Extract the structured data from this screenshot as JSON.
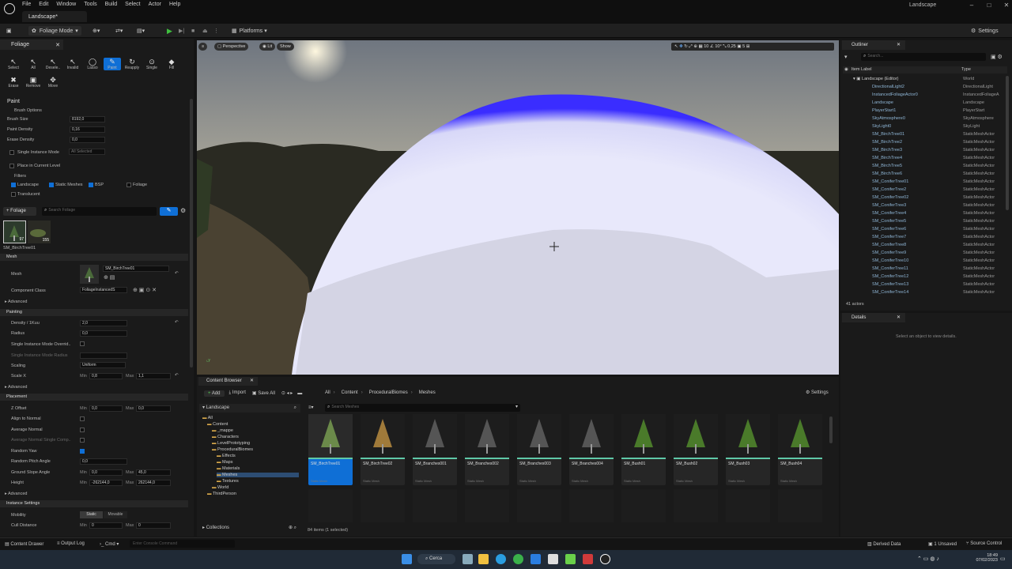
{
  "window": {
    "doc_tab": "Landscape*",
    "project": "Landscape"
  },
  "menu": [
    "File",
    "Edit",
    "Window",
    "Tools",
    "Build",
    "Select",
    "Actor",
    "Help"
  ],
  "toolbar": {
    "mode": "Foliage Mode",
    "platforms": "Platforms",
    "settings": "Settings"
  },
  "foliage_panel": {
    "tab": "Foliage",
    "tools": [
      {
        "label": "Select",
        "g": "↖"
      },
      {
        "label": "All",
        "g": "↖"
      },
      {
        "label": "Desele..",
        "g": "↖"
      },
      {
        "label": "Invalid",
        "g": "↖"
      },
      {
        "label": "Lasso",
        "g": "◯"
      },
      {
        "label": "Paint",
        "g": "✎"
      },
      {
        "label": "Reapply",
        "g": "↻"
      },
      {
        "label": "Single",
        "g": "⊙"
      },
      {
        "label": "Fill",
        "g": "◆"
      }
    ],
    "tools2": [
      {
        "label": "Erase",
        "g": "✖"
      },
      {
        "label": "Remove",
        "g": "▣"
      },
      {
        "label": "Move",
        "g": "✥"
      }
    ],
    "heading": "Paint",
    "brush_options": "Brush Options",
    "brush_size_label": "Brush Size",
    "brush_size": "8192,0",
    "paint_density_label": "Paint Density",
    "paint_density": "0,16",
    "erase_density_label": "Erase Density",
    "erase_density": "0,0",
    "single_instance_label": "Single Instance Mode",
    "single_instance_value": "All Selected",
    "place_in_level": "Place in Current Level",
    "filters": "Filters",
    "filter_landscape": "Landscape",
    "filter_static": "Static Meshes",
    "filter_bsp": "BSP",
    "filter_foliage": "Foliage",
    "filter_translucent": "Translucent",
    "add_foliage": "+ Foliage",
    "search_placeholder": "Search Foliage",
    "count1": "97",
    "count2": "155",
    "selected_name": "SM_BirchTree01",
    "mesh_section": "Mesh",
    "mesh_label": "Mesh",
    "mesh_value": "SM_BirchTree01",
    "component_class_label": "Component Class",
    "component_class": "FoliageInstancedS",
    "advanced": "Advanced",
    "painting": "Painting",
    "density_label": "Density / 1Kuu",
    "density": "2,0",
    "radius_label": "Radius",
    "radius": "0,0",
    "single_override": "Single Instance Mode Overrid..",
    "single_radius": "Single Instance Mode Radius",
    "scaling_label": "Scaling",
    "scaling": "Uniform",
    "scalex_label": "Scale X",
    "min": "Min",
    "max": "Max",
    "scalex_min": "0,8",
    "scalex_max": "1,1",
    "placement": "Placement",
    "zoffset_label": "Z Offset",
    "zoffset_min": "0,0",
    "zoffset_max": "0,0",
    "align_label": "Align to Normal",
    "avg_normal": "Average Normal",
    "avg_single": "Average Normal Single Comp..",
    "random_yaw": "Random Yaw",
    "random_pitch": "Random Pitch Angle",
    "pitch": "0,0",
    "slope_label": "Ground Slope Angle",
    "slope_min": "0,0",
    "slope_max": "45,0",
    "height_label": "Height",
    "height_min": "-262144,0",
    "height_max": "262144,0",
    "instance_settings": "Instance Settings",
    "mobility_label": "Mobility",
    "mobility_static": "Static",
    "mobility_movable": "Movable",
    "cull_label": "Cull Distance",
    "cull_min": "0",
    "cull_max": "0"
  },
  "viewport": {
    "perspective": "Perspective",
    "lit": "Lit",
    "show": "Show",
    "grid": "10",
    "angle": "10°",
    "scale": "0,25",
    "cam": "5"
  },
  "outliner": {
    "tab": "Outliner",
    "search_placeholder": "Search...",
    "col_label": "Item Label",
    "col_type": "Type",
    "root": "Landscape (Editor)",
    "root_type": "World",
    "items": [
      [
        "DirectionalLight2",
        "DirectionalLight"
      ],
      [
        "InstancedFoliageActor0",
        "InstancedFoliageA"
      ],
      [
        "Landscape",
        "Landscape"
      ],
      [
        "PlayerStart1",
        "PlayerStart"
      ],
      [
        "SkyAtmosphere0",
        "SkyAtmosphere"
      ],
      [
        "SkyLight0",
        "SkyLight"
      ],
      [
        "SM_BirchTree01",
        "StaticMeshActor"
      ],
      [
        "SM_BirchTree2",
        "StaticMeshActor"
      ],
      [
        "SM_BirchTree3",
        "StaticMeshActor"
      ],
      [
        "SM_BirchTree4",
        "StaticMeshActor"
      ],
      [
        "SM_BirchTree5",
        "StaticMeshActor"
      ],
      [
        "SM_BirchTree6",
        "StaticMeshActor"
      ],
      [
        "SM_ConiferTree01",
        "StaticMeshActor"
      ],
      [
        "SM_ConiferTree2",
        "StaticMeshActor"
      ],
      [
        "SM_ConiferTree02",
        "StaticMeshActor"
      ],
      [
        "SM_ConiferTree3",
        "StaticMeshActor"
      ],
      [
        "SM_ConiferTree4",
        "StaticMeshActor"
      ],
      [
        "SM_ConiferTree5",
        "StaticMeshActor"
      ],
      [
        "SM_ConiferTree6",
        "StaticMeshActor"
      ],
      [
        "SM_ConiferTree7",
        "StaticMeshActor"
      ],
      [
        "SM_ConiferTree8",
        "StaticMeshActor"
      ],
      [
        "SM_ConiferTree9",
        "StaticMeshActor"
      ],
      [
        "SM_ConiferTree10",
        "StaticMeshActor"
      ],
      [
        "SM_ConiferTree11",
        "StaticMeshActor"
      ],
      [
        "SM_ConiferTree12",
        "StaticMeshActor"
      ],
      [
        "SM_ConiferTree13",
        "StaticMeshActor"
      ],
      [
        "SM_ConiferTree14",
        "StaticMeshActor"
      ]
    ],
    "count": "41 actors"
  },
  "details": {
    "tab": "Details",
    "empty": "Select an object to view details."
  },
  "content_browser": {
    "tab": "Content Browser",
    "add": "Add",
    "import": "Import",
    "save_all": "Save All",
    "settings": "Settings",
    "crumbs": [
      "All",
      "Content",
      "ProceduralBiomes",
      "Meshes"
    ],
    "root_label": "Landscape",
    "search_placeholder": "Search Meshes",
    "tree": [
      "All",
      "Content",
      "_mappe",
      "Characters",
      "LevelPrototyping",
      "ProceduralBiomes",
      "Effects",
      "Maps",
      "Materials",
      "Meshes",
      "Textures",
      "World",
      "ThirdPerson"
    ],
    "assets": [
      "SM_BirchTree01",
      "SM_BirchTree02",
      "SM_Branches001",
      "SM_Branches002",
      "SM_Branches003",
      "SM_Branches004",
      "SM_Bush01",
      "SM_Bush02",
      "SM_Bush03",
      "SM_Bush04"
    ],
    "asset_type": "Static Mesh",
    "collections": "Collections",
    "status": "84 items (1 selected)"
  },
  "statusbar": {
    "drawer": "Content Drawer",
    "output": "Output Log",
    "cmd": "Cmd",
    "console": "Enter Console Command",
    "derived": "Derived Data",
    "unsaved": "1 Unsaved",
    "source": "Source Control"
  },
  "taskbar": {
    "search": "Cerca",
    "time": "18:49",
    "date": "07/02/2023"
  }
}
